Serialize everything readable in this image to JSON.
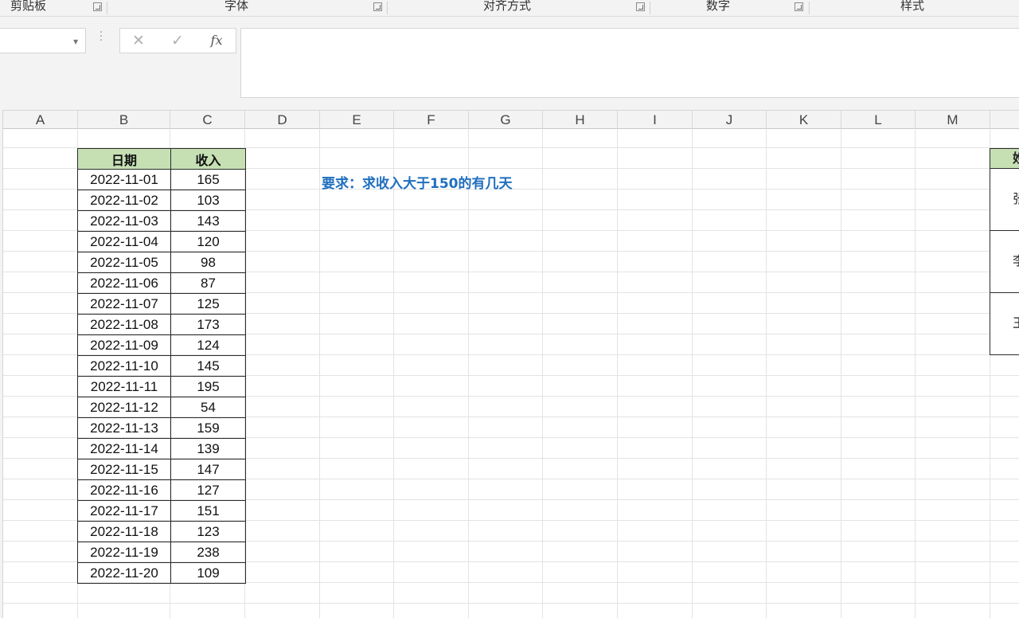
{
  "ribbon": {
    "groups": [
      {
        "label": "剪贴板"
      },
      {
        "label": "字体"
      },
      {
        "label": "对齐方式"
      },
      {
        "label": "数字"
      },
      {
        "label": "样式"
      }
    ]
  },
  "formula_bar": {
    "name_box": "",
    "cancel_icon": "✕",
    "enter_icon": "✓",
    "fx_label": "fx",
    "content": ""
  },
  "columns": [
    "A",
    "B",
    "C",
    "D",
    "E",
    "F",
    "G",
    "H",
    "I",
    "J",
    "K",
    "L",
    "M"
  ],
  "table": {
    "header_date": "日期",
    "header_income": "收入",
    "rows": [
      {
        "date": "2022-11-01",
        "income": "165"
      },
      {
        "date": "2022-11-02",
        "income": "103"
      },
      {
        "date": "2022-11-03",
        "income": "143"
      },
      {
        "date": "2022-11-04",
        "income": "120"
      },
      {
        "date": "2022-11-05",
        "income": "98"
      },
      {
        "date": "2022-11-06",
        "income": "87"
      },
      {
        "date": "2022-11-07",
        "income": "125"
      },
      {
        "date": "2022-11-08",
        "income": "173"
      },
      {
        "date": "2022-11-09",
        "income": "124"
      },
      {
        "date": "2022-11-10",
        "income": "145"
      },
      {
        "date": "2022-11-11",
        "income": "195"
      },
      {
        "date": "2022-11-12",
        "income": "54"
      },
      {
        "date": "2022-11-13",
        "income": "159"
      },
      {
        "date": "2022-11-14",
        "income": "139"
      },
      {
        "date": "2022-11-15",
        "income": "147"
      },
      {
        "date": "2022-11-16",
        "income": "127"
      },
      {
        "date": "2022-11-17",
        "income": "151"
      },
      {
        "date": "2022-11-18",
        "income": "123"
      },
      {
        "date": "2022-11-19",
        "income": "238"
      },
      {
        "date": "2022-11-20",
        "income": "109"
      }
    ]
  },
  "note": "要求：求收入大于150的有几天",
  "right_table": {
    "header": "姓",
    "cells": [
      "张",
      "李",
      "王"
    ]
  },
  "colors": {
    "header_fill": "#c6e0b4",
    "note_text": "#1f6fbf",
    "chrome_bg": "#f3f3f3"
  }
}
